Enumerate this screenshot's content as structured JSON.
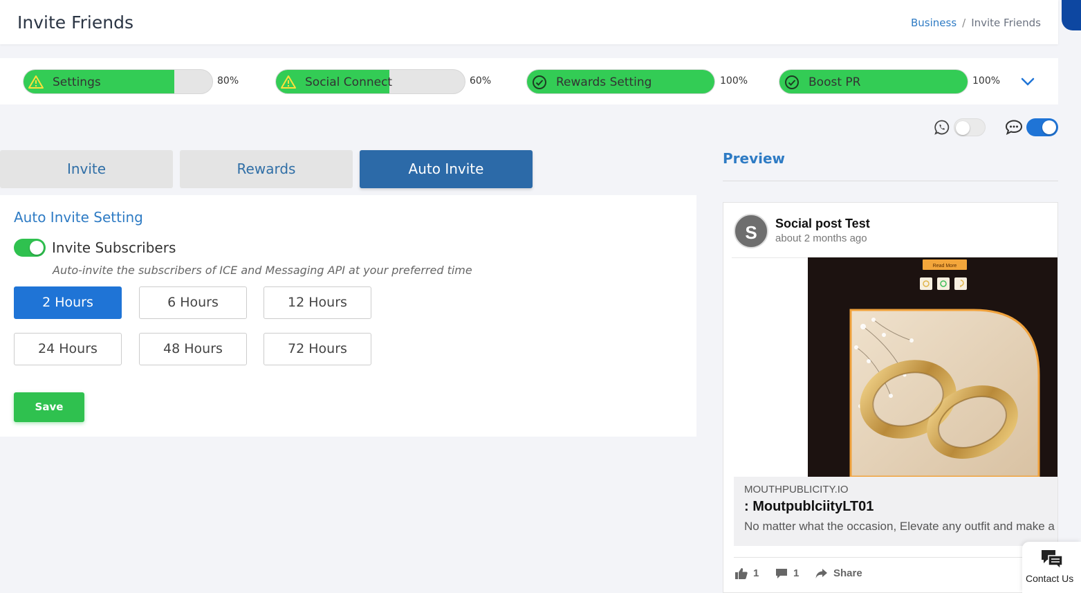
{
  "header": {
    "title": "Invite Friends",
    "breadcrumb": {
      "parent": "Business",
      "separator": "/",
      "current": "Invite Friends"
    }
  },
  "progress": {
    "items": [
      {
        "label": "Settings",
        "percent_text": "80%",
        "value": 0.8,
        "status": "warning",
        "icon": "warning-icon"
      },
      {
        "label": "Social Connect",
        "percent_text": "60%",
        "value": 0.6,
        "status": "warning",
        "icon": "warning-icon"
      },
      {
        "label": "Rewards Setting",
        "percent_text": "100%",
        "value": 1.0,
        "status": "complete",
        "icon": "check-circle-icon"
      },
      {
        "label": "Boost PR",
        "percent_text": "100%",
        "value": 1.0,
        "status": "complete",
        "icon": "check-circle-icon"
      }
    ],
    "expand_icon": "chevron-down-icon"
  },
  "channels": {
    "whatsapp": {
      "icon": "whatsapp-icon",
      "enabled": false
    },
    "sms": {
      "icon": "chat-bubble-icon",
      "enabled": true
    }
  },
  "tabs": [
    {
      "label": "Invite",
      "active": false
    },
    {
      "label": "Rewards",
      "active": false
    },
    {
      "label": "Auto Invite",
      "active": true
    }
  ],
  "auto_invite": {
    "title": "Auto Invite Setting",
    "invite_subscribers": {
      "label": "Invite Subscribers",
      "enabled": true,
      "description": "Auto-invite the subscribers of ICE and Messaging API at your preferred time"
    },
    "hours": [
      {
        "label": "2 Hours",
        "selected": true
      },
      {
        "label": "6 Hours",
        "selected": false
      },
      {
        "label": "12 Hours",
        "selected": false
      },
      {
        "label": "24 Hours",
        "selected": false
      },
      {
        "label": "48 Hours",
        "selected": false
      },
      {
        "label": "72 Hours",
        "selected": false
      }
    ],
    "save_label": "Save"
  },
  "preview": {
    "title": "Preview",
    "post": {
      "avatar_letter": "S",
      "author": "Social post Test",
      "time": "about 2 months ago",
      "image_button_text": "Read More",
      "link": {
        "domain": "MOUTHPUBLICITY.IO",
        "title": ": MoutpublciityLT01",
        "description": "No matter what the occasion, Elevate any outfit and make a"
      },
      "actions": {
        "likes": "1",
        "comments": "1",
        "share": "Share"
      }
    }
  },
  "contact": {
    "label": "Contact Us",
    "icon": "chat-bubbles-icon"
  },
  "colors": {
    "accent_blue": "#2e7bc4",
    "active_tab": "#2c6aa8",
    "selected_hour": "#1f74d6",
    "progress_green": "#33cc55",
    "save_green": "#2fc14f"
  }
}
